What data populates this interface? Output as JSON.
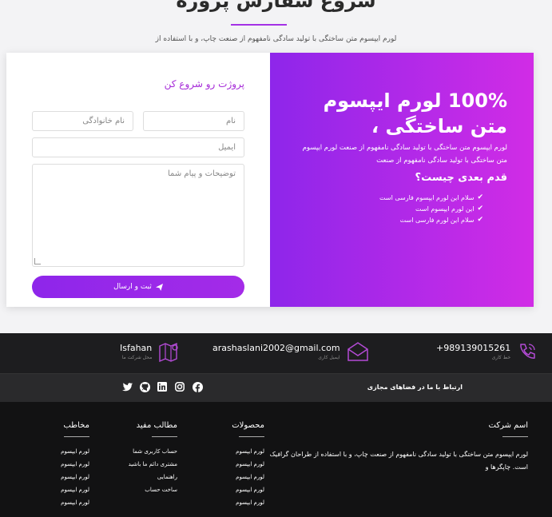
{
  "header": {
    "title": "شروع سفارش پروژه",
    "subtitle": "لورم ایپسوم متن ساختگی با تولید سادگی نامفهوم از صنعت چاپ، و با استفاده از"
  },
  "form": {
    "title": "پروژت رو شروع کن",
    "first_name_placeholder": "نام",
    "last_name_placeholder": "نام خانوادگی",
    "email_placeholder": "ایمیل",
    "description_placeholder": "توضیحات و پیام شما",
    "submit_label": "ثبت و ارسال"
  },
  "hero": {
    "title": "100% لورم ایپسوم متن ساختگی ،",
    "description": "لورم ایپسوم متن ساختگی با تولید سادگی نامفهوم از صنعت لورم ایپسوم متن ساختگی با تولید سادگی نامفهوم از صنعت",
    "next_title": "قدم بعدی چیست؟",
    "steps": [
      "سلام این لورم ایپسوم فارسی است",
      "این لورم ایپسوم است",
      "سلام این لورم فارسی است"
    ]
  },
  "contact": {
    "phone": "+989139015261",
    "phone_label": "خط کاری",
    "email": "arashaslani2002@gmail.com",
    "email_label": "ایمیل کاری",
    "city": "Isfahan",
    "city_label": "محل شرکت ما"
  },
  "social": {
    "label": "ارتباط با ما در فضاهای مجازی"
  },
  "footer": {
    "about": {
      "title": "اسم شرکت",
      "text": "لورم ایپسوم متن ساختگی با تولید سادگی نامفهوم از صنعت چاپ، و با استفاده از طراحان گرافیک است. چاپگرها و"
    },
    "products": {
      "title": "محصولات",
      "links": [
        "لورم ایپسوم",
        "لورم ایپسوم",
        "لورم ایپسوم",
        "لورم ایپسوم",
        "لورم ایپسوم"
      ]
    },
    "useful": {
      "title": "مطالب مفید",
      "links": [
        "حساب کاربری شما",
        "مشتری دائم ما باشید",
        "راهنمایی",
        "ساخت حساب"
      ]
    },
    "audience": {
      "title": "مخاطب",
      "links": [
        "لورم ایپسوم",
        "لورم ایپسوم",
        "لورم ایپسوم",
        "لورم ایپسوم",
        "لورم ایپسوم"
      ]
    }
  },
  "colors": {
    "accent": "#a431e6",
    "gradient_start": "#8e26ea",
    "gradient_end": "#d12ce6",
    "dark": "#1d1d1f"
  }
}
